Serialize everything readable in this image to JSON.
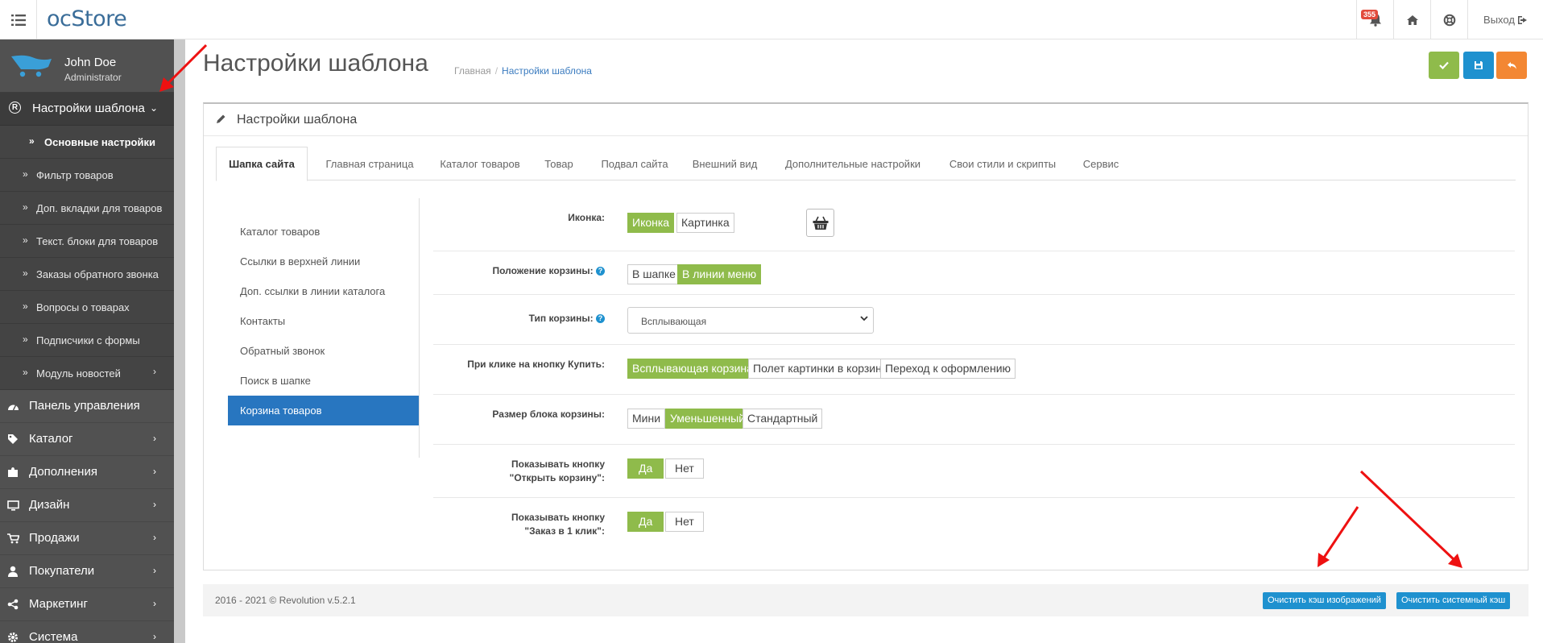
{
  "header": {
    "logo_oc": "oc",
    "logo_store": "Store",
    "notification_count": "355",
    "logout_label": "Выход"
  },
  "sidebar": {
    "user_name": "John Doe",
    "user_role": "Administrator",
    "active_section": "Настройки шаблона",
    "sub_items": [
      {
        "label": "Основные настройки"
      },
      {
        "label": "Фильтр товаров"
      },
      {
        "label": "Доп. вкладки для товаров"
      },
      {
        "label": "Текст. блоки для товаров"
      },
      {
        "label": "Заказы обратного звонка"
      },
      {
        "label": "Вопросы о товарах"
      },
      {
        "label": "Подписчики с формы"
      },
      {
        "label": "Модуль новостей"
      }
    ],
    "main_items": [
      {
        "label": "Панель управления",
        "icon": "dashboard-icon"
      },
      {
        "label": "Каталог",
        "icon": "tag-icon"
      },
      {
        "label": "Дополнения",
        "icon": "puzzle-icon"
      },
      {
        "label": "Дизайн",
        "icon": "monitor-icon"
      },
      {
        "label": "Продажи",
        "icon": "cart-icon"
      },
      {
        "label": "Покупатели",
        "icon": "user-icon"
      },
      {
        "label": "Маркетинг",
        "icon": "share-icon"
      },
      {
        "label": "Система",
        "icon": "cog-icon"
      }
    ]
  },
  "page": {
    "title": "Настройки шаблона",
    "breadcrumb_home": "Главная",
    "breadcrumb_sep": "/",
    "breadcrumb_current": "Настройки шаблона"
  },
  "panel": {
    "title": "Настройки шаблона",
    "tabs": [
      {
        "label": "Шапка сайта"
      },
      {
        "label": "Главная страница"
      },
      {
        "label": "Каталог товаров"
      },
      {
        "label": "Товар"
      },
      {
        "label": "Подвал сайта"
      },
      {
        "label": "Внешний вид"
      },
      {
        "label": "Дополнительные настройки"
      },
      {
        "label": "Свои стили и скрипты"
      },
      {
        "label": "Сервис"
      }
    ],
    "vnav": [
      {
        "label": "Каталог товаров"
      },
      {
        "label": "Ссылки в верхней линии"
      },
      {
        "label": "Доп. ссылки в линии каталога"
      },
      {
        "label": "Контакты"
      },
      {
        "label": "Обратный звонок"
      },
      {
        "label": "Поиск в шапке"
      },
      {
        "label": "Корзина товаров"
      }
    ],
    "fields": {
      "icon": {
        "label": "Иконка:",
        "options": [
          "Иконка",
          "Картинка"
        ],
        "selected": "Иконка"
      },
      "cart_position": {
        "label": "Положение корзины:",
        "help": "?",
        "options": [
          "В шапке",
          "В линии меню"
        ],
        "selected": "В линии меню"
      },
      "cart_type": {
        "label": "Тип корзины:",
        "help": "?",
        "value": "Всплывающая"
      },
      "on_buy": {
        "label": "При клике на кнопку Купить:",
        "options": [
          "Всплывающая корзина",
          "Полет картинки в корзину",
          "Переход к оформлению"
        ],
        "selected": "Всплывающая корзина"
      },
      "cart_size": {
        "label": "Размер блока корзины:",
        "options": [
          "Мини",
          "Уменьшенный",
          "Стандартный"
        ],
        "selected": "Уменьшенный"
      },
      "show_open_cart": {
        "label_line1": "Показывать кнопку",
        "label_line2": "\"Открыть корзину\":",
        "options": [
          "Да",
          "Нет"
        ],
        "selected": "Да"
      },
      "show_one_click": {
        "label_line1": "Показывать кнопку",
        "label_line2": "\"Заказ в 1 клик\":",
        "options": [
          "Да",
          "Нет"
        ],
        "selected": "Да"
      }
    }
  },
  "footer": {
    "copyright": "2016 - 2021 © Revolution v.5.2.1",
    "clear_images_cache": "Очистить кэш изображений",
    "clear_system_cache": "Очистить системный кэш"
  },
  "colors": {
    "sidebar_bg": "#515151",
    "active_green": "#8fbb4b",
    "primary_blue": "#1e91cf",
    "active_nav_blue": "#2876c0",
    "back_orange": "#f38733",
    "annotation_red": "#ee1111"
  }
}
